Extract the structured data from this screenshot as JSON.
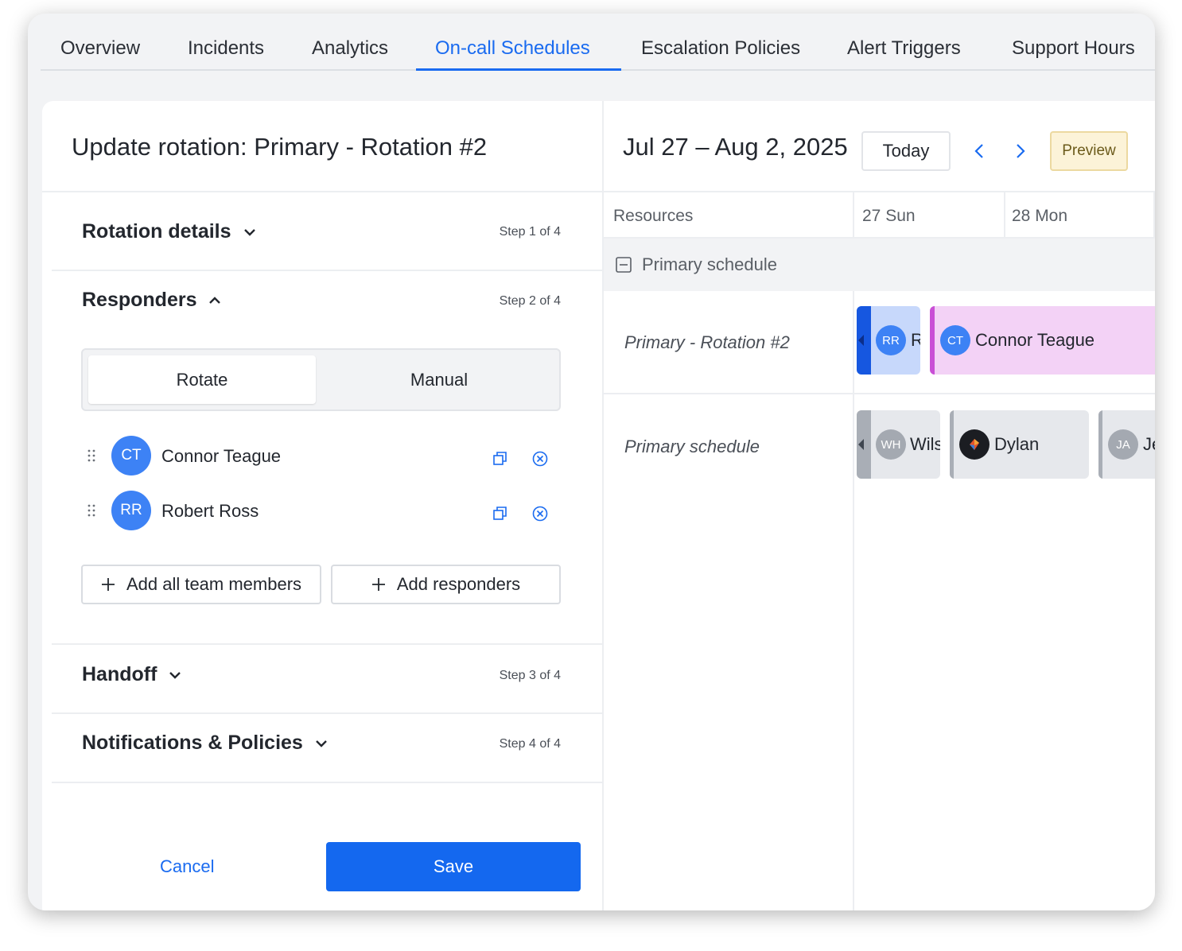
{
  "tabs": [
    {
      "label": "Overview"
    },
    {
      "label": "Incidents"
    },
    {
      "label": "Analytics"
    },
    {
      "label": "On-call Schedules"
    },
    {
      "label": "Escalation Policies"
    },
    {
      "label": "Alert Triggers"
    },
    {
      "label": "Support Hours"
    }
  ],
  "active_tab": "On-call Schedules",
  "form": {
    "title": "Update rotation: Primary - Rotation #2",
    "sections": [
      {
        "label": "Rotation details",
        "step": "Step 1 of 4",
        "expanded": false
      },
      {
        "label": "Responders",
        "step": "Step 2 of 4",
        "expanded": true
      },
      {
        "label": "Handoff",
        "step": "Step 3 of 4",
        "expanded": false
      },
      {
        "label": "Notifications & Policies",
        "step": "Step 4 of 4",
        "expanded": false
      }
    ],
    "mode_toggle": {
      "options": [
        "Rotate",
        "Manual"
      ],
      "selected": "Rotate"
    },
    "responders": [
      {
        "initials": "CT",
        "name": "Connor Teague"
      },
      {
        "initials": "RR",
        "name": "Robert Ross"
      }
    ],
    "add_all_label": "Add all team members",
    "add_responders_label": "Add responders",
    "cancel_label": "Cancel",
    "save_label": "Save"
  },
  "calendar": {
    "date_range": "Jul 27 – Aug 2, 2025",
    "today_label": "Today",
    "preview_label": "Preview",
    "resources_header": "Resources",
    "days": [
      "27 Sun",
      "28 Mon"
    ],
    "group_label": "Primary schedule",
    "rows": [
      {
        "label": "Primary - Rotation #2",
        "events": [
          {
            "initials": "RR",
            "name": "R"
          },
          {
            "initials": "CT",
            "name": "Connor Teague"
          }
        ]
      },
      {
        "label": "Primary schedule",
        "events": [
          {
            "initials": "WH",
            "name": "Wils"
          },
          {
            "initials": "",
            "name": "Dylan"
          },
          {
            "initials": "JA",
            "name": "Je"
          }
        ]
      }
    ]
  },
  "colors": {
    "accent": "#1a6bf0",
    "avatar_blue": "#3d82f5",
    "rr_event_bg": "#c7d8fb",
    "ct_event_bg": "#f3d2f6",
    "ct_event_bar": "#c94fd6",
    "grey_event_bg": "#e6e8ec"
  }
}
